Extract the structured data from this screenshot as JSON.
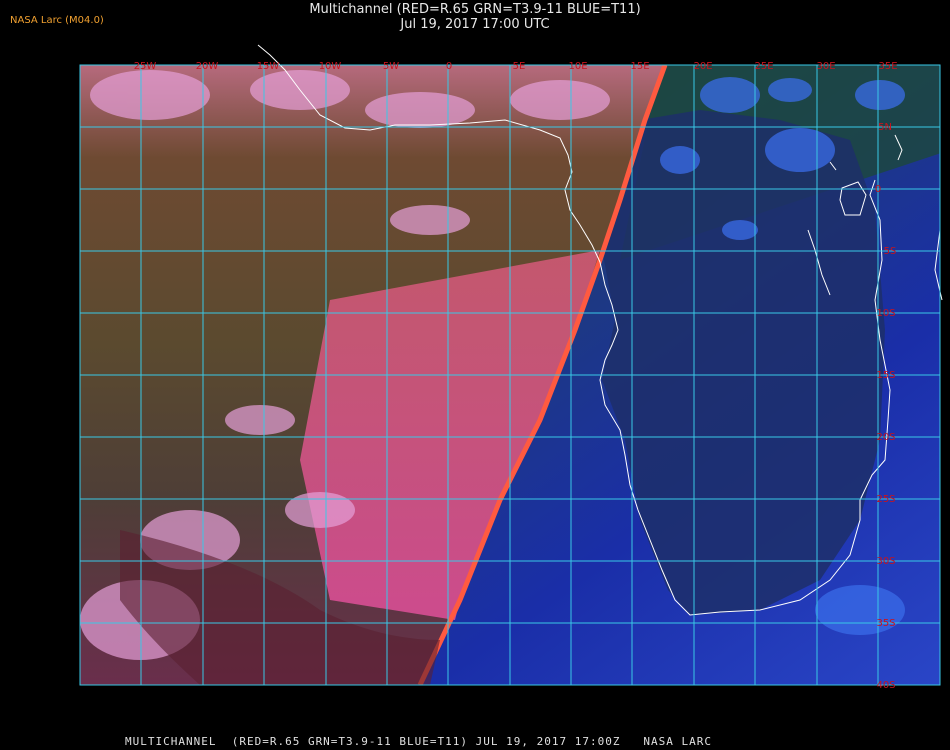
{
  "credit": "NASA Larc (M04.0)",
  "title": "Multichannel (RED=R.65 GRN=T3.9-11 BLUE=T11)",
  "subtitle": "Jul 19, 2017 17:00 UTC",
  "footer": "MULTICHANNEL  (RED=R.65 GRN=T3.9-11 BLUE=T11) JUL 19, 2017 17:00Z   NASA LARC",
  "colors": {
    "grid": "#39c8e6",
    "label": "#c8141e",
    "coast": "#ffffff",
    "day_red": "#e8455a",
    "night_blue": "#1a3cc8"
  },
  "grid": {
    "lon_labels": [
      "25W",
      "20W",
      "15W",
      "10W",
      "5W",
      "0",
      "5E",
      "10E",
      "15E",
      "20E",
      "25E",
      "30E",
      "35E"
    ],
    "lat_labels": [
      "5N",
      "0",
      "5S",
      "10S",
      "15S",
      "20S",
      "25S",
      "30S",
      "35S",
      "40S"
    ]
  }
}
